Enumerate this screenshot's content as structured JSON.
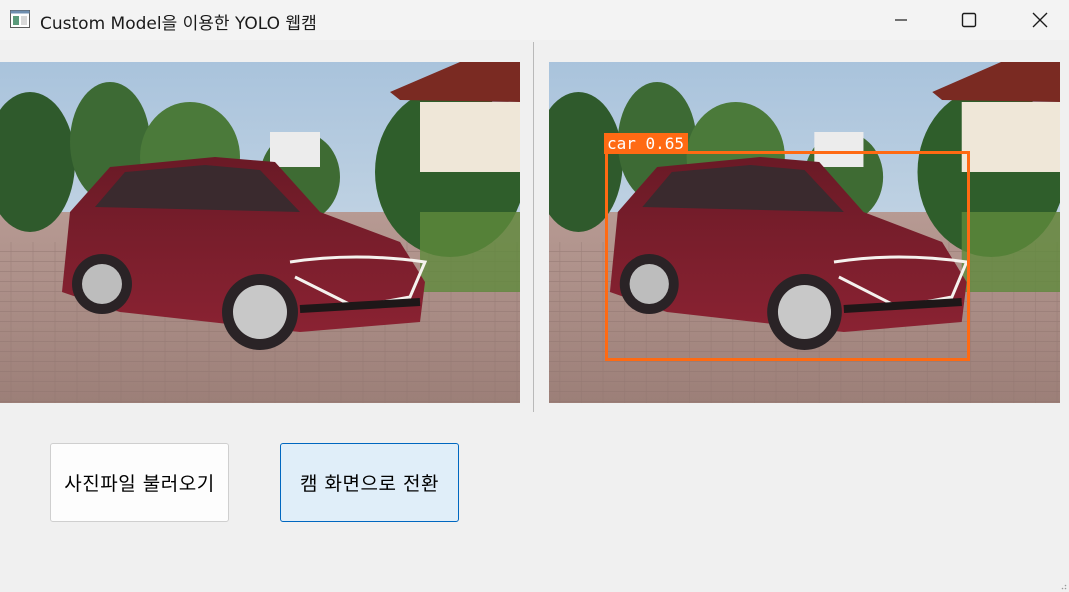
{
  "window": {
    "title": "Custom Model을 이용한 YOLO 웹캠",
    "icon": "app-window-icon",
    "controls": [
      "minimize-icon",
      "maximize-icon",
      "close-icon"
    ]
  },
  "panels": {
    "left": {
      "content": "car photo"
    },
    "right": {
      "content": "car photo with detection",
      "detection": {
        "label": "car 0.65",
        "class": "car",
        "confidence": 0.65,
        "color": "#ff6a13"
      }
    }
  },
  "buttons": {
    "load_label": "사진파일 불러오기",
    "cam_label": "캠 화면으로 전환"
  },
  "colors": {
    "window_bg": "#f0f0f0",
    "accent_border": "#0067c0",
    "accent_fill": "#e0eef9",
    "detection_box": "#ff6a13"
  }
}
